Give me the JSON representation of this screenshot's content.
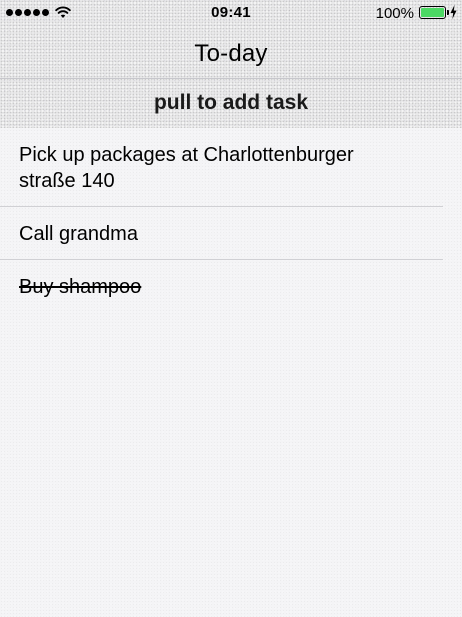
{
  "status_bar": {
    "time": "09:41",
    "battery_percent": "100%",
    "battery_level": 1.0,
    "signal_bars": 5,
    "battery_color": "#4cd964"
  },
  "nav": {
    "title": "To-day"
  },
  "pull_hint": "pull to add task",
  "tasks": [
    {
      "text": "Pick up packages at Charlottenburger straße 140",
      "done": false
    },
    {
      "text": "Call grandma",
      "done": false
    },
    {
      "text": "Buy shampoo",
      "done": true
    }
  ]
}
